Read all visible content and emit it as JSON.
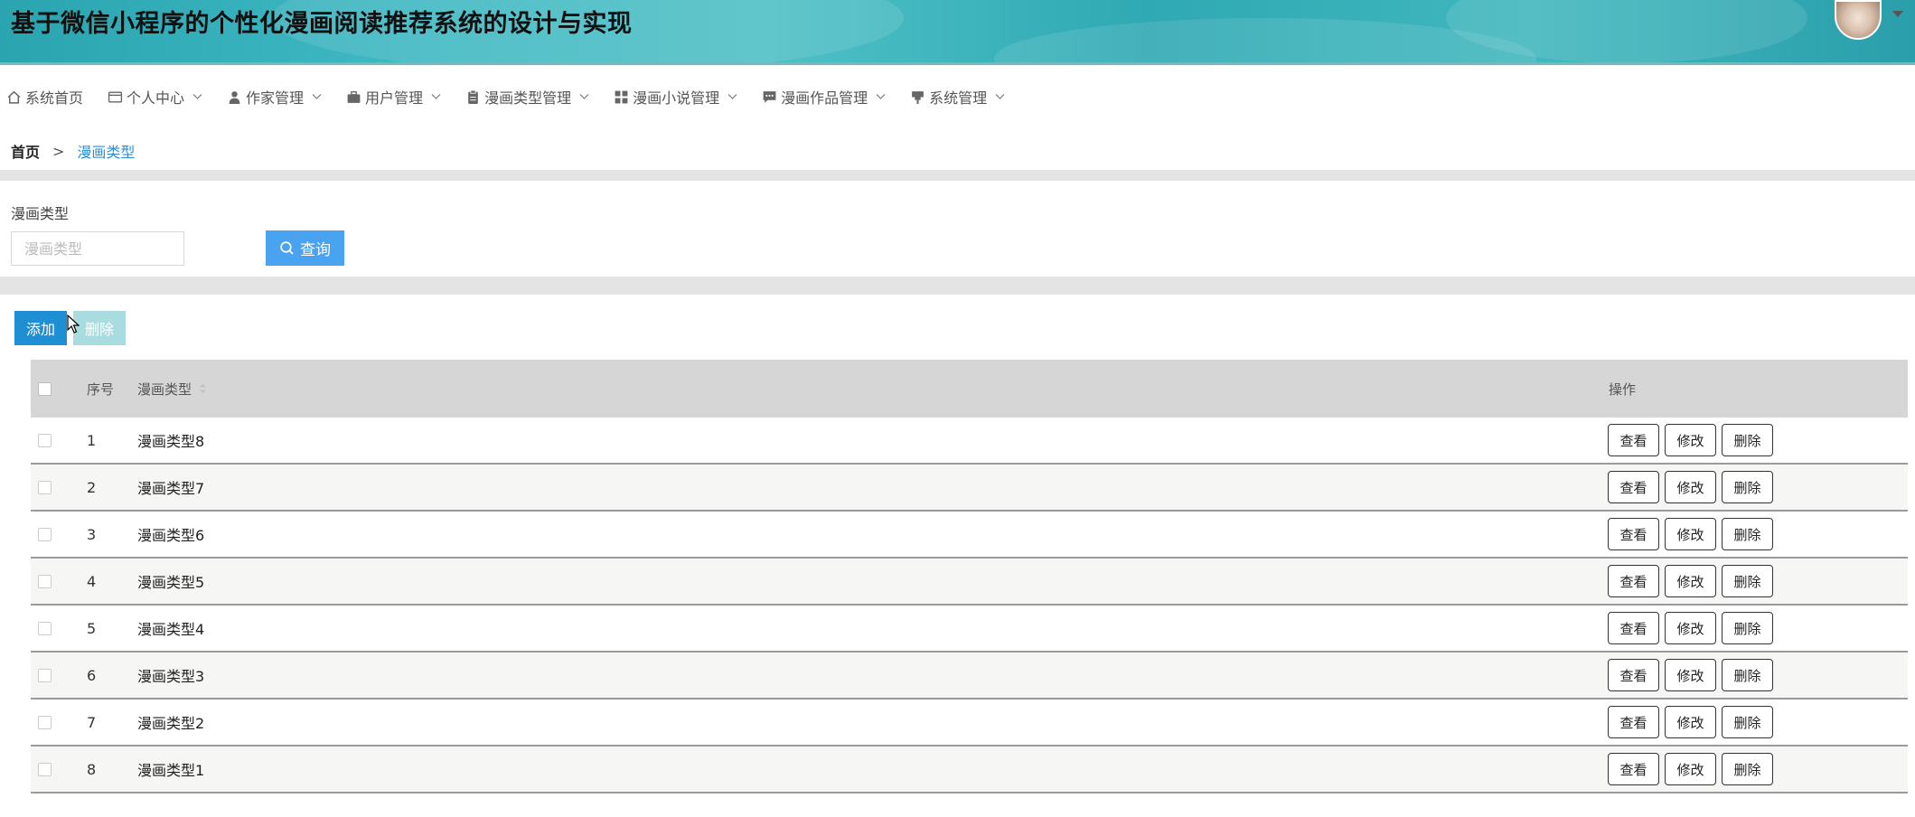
{
  "header": {
    "title": "基于微信小程序的个性化漫画阅读推荐系统的设计与实现"
  },
  "nav": {
    "items": [
      {
        "label": "系统首页",
        "icon": "home-icon",
        "has_dropdown": false
      },
      {
        "label": "个人中心",
        "icon": "card-icon",
        "has_dropdown": true
      },
      {
        "label": "作家管理",
        "icon": "user-icon",
        "has_dropdown": true
      },
      {
        "label": "用户管理",
        "icon": "briefcase-icon",
        "has_dropdown": true
      },
      {
        "label": "漫画类型管理",
        "icon": "clipboard-icon",
        "has_dropdown": true
      },
      {
        "label": "漫画小说管理",
        "icon": "grid-icon",
        "has_dropdown": true
      },
      {
        "label": "漫画作品管理",
        "icon": "chat-icon",
        "has_dropdown": true
      },
      {
        "label": "系统管理",
        "icon": "pin-icon",
        "has_dropdown": true
      }
    ]
  },
  "breadcrumb": {
    "home": "首页",
    "separator": ">",
    "current": "漫画类型"
  },
  "search": {
    "label": "漫画类型",
    "placeholder": "漫画类型",
    "value": "",
    "button_label": "查询"
  },
  "actions": {
    "add_label": "添加",
    "delete_label": "删除"
  },
  "table": {
    "headers": {
      "index": "序号",
      "type": "漫画类型",
      "ops": "操作"
    },
    "rows": [
      {
        "index": "1",
        "type": "漫画类型8"
      },
      {
        "index": "2",
        "type": "漫画类型7"
      },
      {
        "index": "3",
        "type": "漫画类型6"
      },
      {
        "index": "4",
        "type": "漫画类型5"
      },
      {
        "index": "5",
        "type": "漫画类型4"
      },
      {
        "index": "6",
        "type": "漫画类型3"
      },
      {
        "index": "7",
        "type": "漫画类型2"
      },
      {
        "index": "8",
        "type": "漫画类型1"
      }
    ],
    "row_actions": {
      "view": "查看",
      "edit": "修改",
      "delete": "删除"
    }
  },
  "colors": {
    "primary": "#1f8fd4",
    "query": "#4aa3f0",
    "disabled": "#a9dcdf",
    "link": "#2c8fd6",
    "header_teal": "#3eb7c1"
  }
}
